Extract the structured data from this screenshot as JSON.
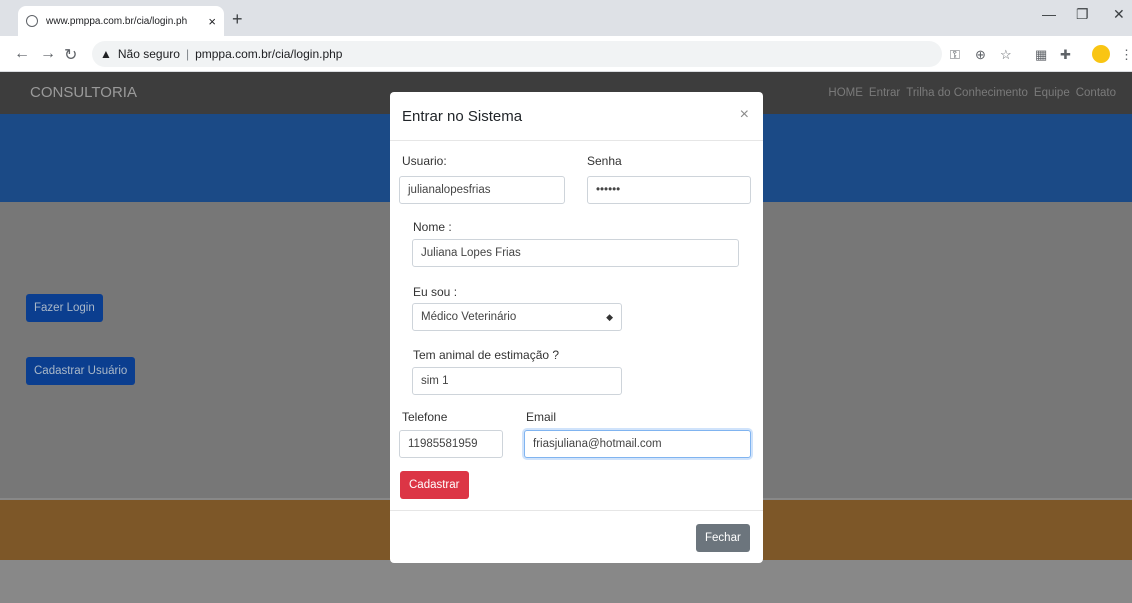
{
  "browser": {
    "tab_title": "www.pmppa.com.br/cia/login.ph",
    "tab_close": "×",
    "new_tab": "+",
    "security_label": "Não seguro",
    "separator": "|",
    "url": "pmppa.com.br/cia/login.php"
  },
  "site": {
    "brand": "CONSULTORIA",
    "nav": [
      "HOME",
      "Entrar",
      "Trilha do Conhecimento",
      "Equipe",
      "Contato"
    ],
    "login_button": "Fazer Login",
    "register_button": "Cadastrar Usuário"
  },
  "modal": {
    "title": "Entrar no Sistema",
    "close": "×",
    "user_label": "Usuario:",
    "user_value": "julianalopesfrias",
    "password_label": "Senha",
    "password_value": "••••••",
    "name_label": "Nome :",
    "name_value": "Juliana Lopes Frias",
    "iam_label": "Eu sou :",
    "iam_value": "Médico Veterinário",
    "pet_label": "Tem animal de estimação ?",
    "pet_value": "sim 1",
    "phone_label": "Telefone",
    "phone_value": "11985581959",
    "email_label": "Email",
    "email_value": "friasjuliana@hotmail.com",
    "submit": "Cadastrar",
    "close_button": "Fechar"
  }
}
